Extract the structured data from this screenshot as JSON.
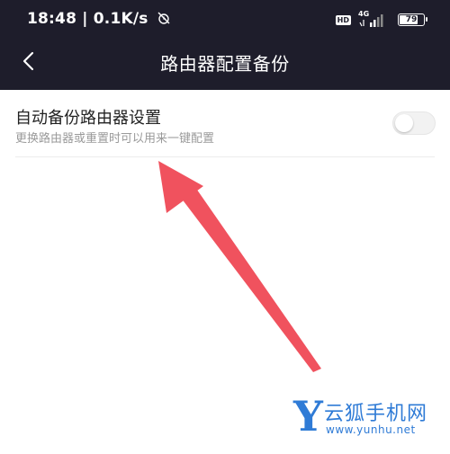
{
  "status_bar": {
    "time": "18:48 | 0.1K/s",
    "hd": "HD",
    "network": "4G",
    "battery_level": "79",
    "battery_fraction": 0.79
  },
  "header": {
    "title": "路由器配置备份",
    "back_icon": "chevron-left-icon"
  },
  "setting": {
    "title": "自动备份路由器设置",
    "subtitle": "更换路由器或重置时可以用来一键配置",
    "toggle_on": false
  },
  "annotation": {
    "arrow_color": "#f0525e"
  },
  "watermark": {
    "letter": "Y",
    "name": "云狐手机网",
    "url": "www.yunhu.net",
    "color": "#2f7bd6"
  },
  "colors": {
    "header_bg": "#1e1d2b",
    "body_bg": "#ffffff"
  }
}
